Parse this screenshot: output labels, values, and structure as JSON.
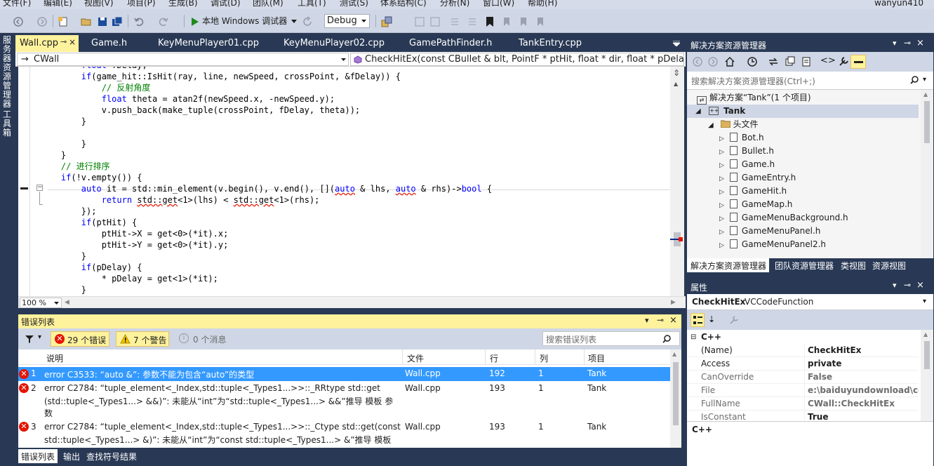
{
  "menu": [
    "文件(F)",
    "编辑(E)",
    "视图(V)",
    "项目(P)",
    "生成(B)",
    "调试(D)",
    "团队(M)",
    "工具(T)",
    "测试(S)",
    "体系结构(C)",
    "分析(N)",
    "窗口(W)",
    "帮助(H)"
  ],
  "user": "wanyun410",
  "toolbar": {
    "debugger": "本地 Windows 调试器",
    "config": "Debug"
  },
  "left_strip": {
    "server_explorer": "服务器资源管理器",
    "toolbox": "工具箱"
  },
  "doc_tabs": [
    "Wall.cpp",
    "Game.h",
    "KeyMenuPlayer01.cpp",
    "KeyMenuPlayer02.cpp",
    "GamePathFinder.h",
    "TankEntry.cpp"
  ],
  "nav": {
    "class": "CWall",
    "member": "CheckHitEx(const CBullet & blt, PointF * ptHit, float * dir, float * pDelay) con"
  },
  "zoom": "100 %",
  "error_list": {
    "title": "错误列表",
    "errors_label": "29 个错误",
    "warnings_label": "7 个警告",
    "messages_label": "0 个消息",
    "search_placeholder": "搜索错误列表",
    "columns": {
      "desc": "说明",
      "file": "文件",
      "line": "行",
      "col": "列",
      "project": "项目"
    },
    "rows": [
      {
        "num": "1",
        "desc": "error C3533: “auto &”: 参数不能为包含“auto”的类型",
        "desc2": "",
        "file": "Wall.cpp",
        "line": "192",
        "col": "1",
        "project": "Tank"
      },
      {
        "num": "2",
        "desc": "error C2784: “tuple_element<_Index,std::tuple<_Types1...>>::_RRtype std::get",
        "desc2": "(std::tuple<_Types1...> &&)”: 未能从“int”为“std::tuple<_Types1...> &&”推导 模板 参",
        "desc3": "数",
        "file": "Wall.cpp",
        "line": "193",
        "col": "1",
        "project": "Tank"
      },
      {
        "num": "3",
        "desc": "error C2784: “tuple_element<_Index,std::tuple<_Types1...>>::_Ctype std::get(const",
        "desc2": "std::tuple<_Types1...> &)”: 未能从“int”为“const std::tuple<_Types1...> &”推导 模板",
        "file": "Wall.cpp",
        "line": "193",
        "col": "1",
        "project": "Tank"
      }
    ]
  },
  "bottom_tabs": [
    "错误列表",
    "输出",
    "查找符号结果"
  ],
  "solution_explorer": {
    "title": "解决方案资源管理器",
    "search_placeholder": "搜索解决方案资源管理器(Ctrl+;)",
    "solution": "解决方案“Tank”(1 个项目)",
    "project": "Tank",
    "folder": "头文件",
    "files": [
      "Bot.h",
      "Bullet.h",
      "Game.h",
      "GameEntry.h",
      "GameHit.h",
      "GameMap.h",
      "GameMenuBackground.h",
      "GameMenuPanel.h",
      "GameMenuPanel2.h"
    ]
  },
  "se_tabs": [
    "解决方案资源管理器",
    "团队资源管理器",
    "类视图",
    "资源视图"
  ],
  "properties": {
    "title": "属性",
    "object": "CheckHitEx",
    "object_type": "VCCodeFunction",
    "category": "C++",
    "rows": [
      {
        "name": "(Name)",
        "value": "CheckHitEx"
      },
      {
        "name": "Access",
        "value": "private"
      },
      {
        "name": "CanOverride",
        "value": "False"
      },
      {
        "name": "File",
        "value": "e:\\baiduyundownload\\coc"
      },
      {
        "name": "FullName",
        "value": "CWall::CheckHitEx"
      },
      {
        "name": "IsConstant",
        "value": "True"
      }
    ],
    "description": "C++"
  },
  "code_lines": [
    [
      "        ",
      "float fDelay;",
      ""
    ],
    [
      "        if(game_hit::IsHit(ray, line, newSpeed, crossPoint, &fDelay)) {"
    ],
    [
      "            // 反射角度"
    ],
    [
      "            float theta = atan2f(newSpeed.x, -newSpeed.y);"
    ],
    [
      "            v.push_back(make_tuple(crossPoint, fDelay, theta));"
    ],
    [
      "        }"
    ],
    [
      ""
    ],
    [
      "    }"
    ],
    [
      "}"
    ],
    [
      "// 进行排序"
    ],
    [
      "if(!v.empty()) {"
    ],
    [
      "    auto it = std::min_element(v.begin(), v.end(), [](auto & lhs, auto & rhs)->bool {"
    ],
    [
      "        return std::get<1>(lhs) < std::get<1>(rhs);"
    ],
    [
      "    });"
    ],
    [
      "    if(ptHit) {"
    ],
    [
      "        ptHit->X = get<0>(*it).x;"
    ],
    [
      "        ptHit->Y = get<0>(*it).y;"
    ],
    [
      "    }"
    ],
    [
      "    if(pDelay) {"
    ],
    [
      "        * pDelay = get<1>(*it);"
    ],
    [
      "    }"
    ]
  ]
}
